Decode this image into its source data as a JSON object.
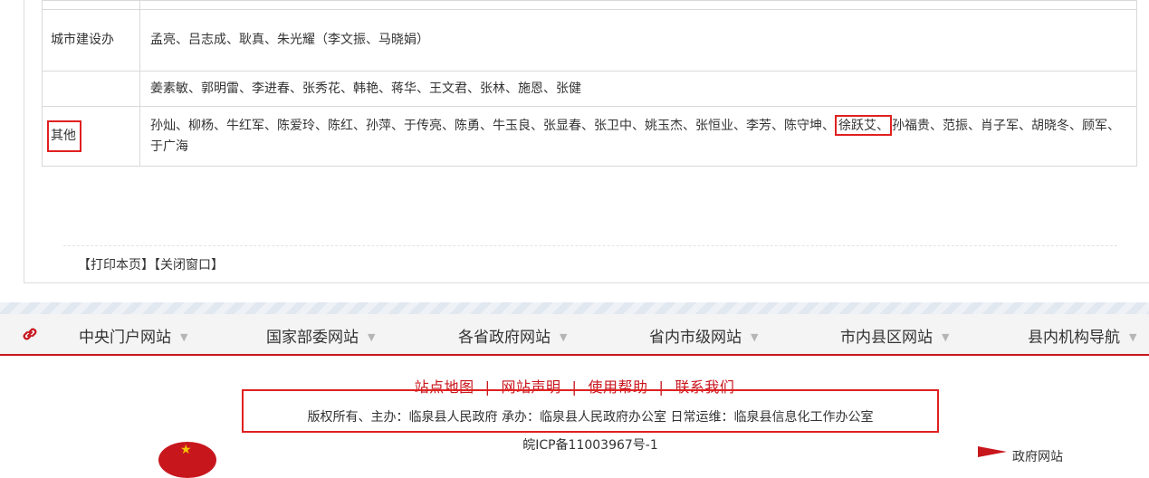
{
  "members": {
    "rows": [
      {
        "label": "城市建设办",
        "names_a": "孟亮、吕志成、耿真、朱光耀（李文振、马晓娟）"
      },
      {
        "label": "",
        "names_a": "姜素敏、郭明雷、李进春、张秀花、韩艳、蒋华、王文君、张林、施恩、张健"
      },
      {
        "label": "其他",
        "names_a": "孙灿、柳杨、牛红军、陈爱玲、陈红、孙萍、于传亮、陈勇、牛玉良、张显春、张卫中、姚玉杰、张恒业、李芳、陈守坤、",
        "names_highlight": "徐跃艾、",
        "names_b": "孙福贵、范振、肖子军、胡晓冬、顾军、于广海"
      }
    ]
  },
  "print_page": "【打印本页】",
  "close_window": "【关闭窗口】",
  "nav": {
    "items": [
      "中央门户网站",
      "国家部委网站",
      "各省政府网站",
      "省内市级网站",
      "市内县区网站",
      "县内机构导航"
    ],
    "caret": "▼"
  },
  "footer": {
    "links": [
      "站点地图",
      "网站声明",
      "使用帮助",
      "联系我们"
    ],
    "separator": "|",
    "copyright": "版权所有、主办：临泉县人民政府 承办：临泉县人民政府办公室 日常运维：临泉县信息化工作办公室",
    "icp": "皖ICP备11003967号-1",
    "right_badge_text": "政府网站"
  },
  "colors": {
    "accent_red": "#c8161d",
    "highlight_red": "#e02020"
  },
  "icons": {
    "nav_link": "chain-link-icon"
  }
}
